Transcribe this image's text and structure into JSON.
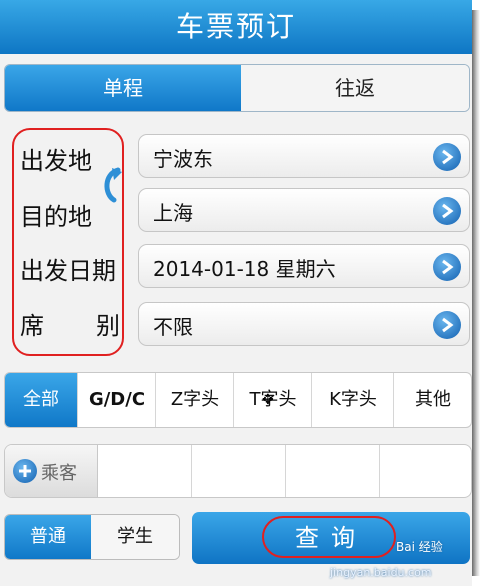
{
  "title": "车票预订",
  "trip_tabs": [
    "单程",
    "往返"
  ],
  "labels": {
    "departure": "出发地",
    "destination": "目的地",
    "date": "出发日期",
    "seat_a": "席",
    "seat_b": "别"
  },
  "fields": {
    "departure": "宁波东",
    "destination": "上海",
    "date": "2014-01-18 星期六",
    "seat": "不限"
  },
  "filters": [
    "全部",
    "G/D/C",
    "Z字头",
    "T字头",
    "K字头",
    "其他"
  ],
  "passenger_label": "乘客",
  "ticket_types": [
    "普通",
    "学生"
  ],
  "query_label": "查询",
  "watermark": {
    "brand": "Bai 经验",
    "url": "jingyan.baidu.com"
  },
  "colors": {
    "accent": "#1078c8",
    "highlight": "#e02020"
  }
}
